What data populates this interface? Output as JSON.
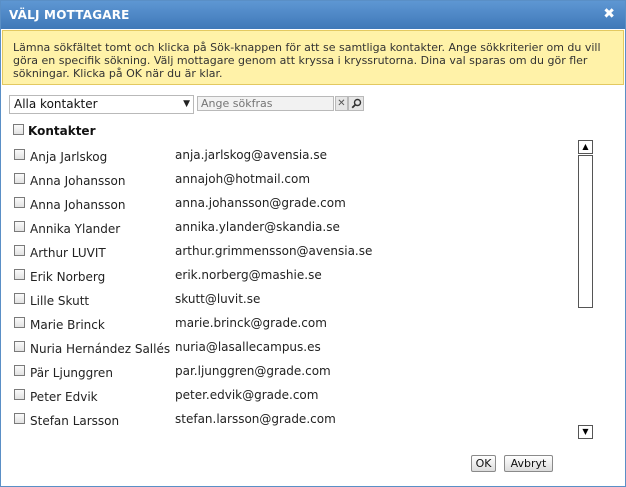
{
  "dialog": {
    "title": "VÄLJ MOTTAGARE",
    "close_symbol": "✖",
    "info_text": "Lämna sökfältet tomt och klicka på Sök-knappen för att se samtliga kontakter. Ange sökkriterier om du vill göra en specifik sökning. Välj mottagare genom att kryssa i kryssrutorna. Dina val sparas om du gör fler sökningar. Klicka på OK när du är klar."
  },
  "filter": {
    "selected": "Alla kontakter",
    "arrow_symbol": "▼"
  },
  "search": {
    "placeholder": "Ange sökfras",
    "clear_symbol": "✕"
  },
  "group": {
    "label": "Kontakter"
  },
  "contacts": [
    {
      "name": "Anja Jarlskog",
      "email": "anja.jarlskog@avensia.se"
    },
    {
      "name": "Anna Johansson",
      "email": "annajoh@hotmail.com"
    },
    {
      "name": "Anna Johansson",
      "email": "anna.johansson@grade.com"
    },
    {
      "name": "Annika Ylander",
      "email": "annika.ylander@skandia.se"
    },
    {
      "name": "Arthur LUVIT",
      "email": "arthur.grimmensson@avensia.se"
    },
    {
      "name": "Erik Norberg",
      "email": "erik.norberg@mashie.se"
    },
    {
      "name": "Lille Skutt",
      "email": "skutt@luvit.se"
    },
    {
      "name": "Marie Brinck",
      "email": "marie.brinck@grade.com"
    },
    {
      "name": "Nuria Hernández Sallés",
      "email": "nuria@lasallecampus.es"
    },
    {
      "name": "Pär Ljunggren",
      "email": "par.ljunggren@grade.com"
    },
    {
      "name": "Peter Edvik",
      "email": "peter.edvik@grade.com"
    },
    {
      "name": "Stefan Larsson",
      "email": "stefan.larsson@grade.com"
    }
  ],
  "scrollbar": {
    "up_symbol": "▲",
    "down_symbol": "▼"
  },
  "buttons": {
    "ok": "OK",
    "cancel": "Avbryt"
  }
}
